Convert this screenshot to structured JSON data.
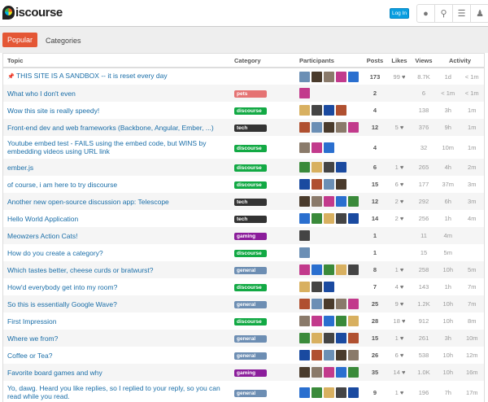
{
  "header": {
    "logo": "Discourse",
    "login": "Log In",
    "icons": [
      "chat-icon",
      "search-icon",
      "menu-icon",
      "user-icon"
    ]
  },
  "nav": {
    "popular": "Popular",
    "categories": "Categories"
  },
  "columns": {
    "topic": "Topic",
    "category": "Category",
    "participants": "Participants",
    "posts": "Posts",
    "likes": "Likes",
    "views": "Views",
    "activity": "Activity"
  },
  "colors": {
    "pets": "#e57373",
    "discourse": "#12a944",
    "tech": "#333333",
    "gaming": "#8b1d9b",
    "general": "#6d8eb3"
  },
  "rows": [
    {
      "title": "THIS SITE IS A SANDBOX -- it is reset every day",
      "pinned": true,
      "category": "",
      "avatars": 5,
      "posts": "173",
      "likes": "99",
      "views": "8.7K",
      "created": "1d",
      "last": "< 1m"
    },
    {
      "title": "What who I don't even",
      "category": "pets",
      "avatars": 1,
      "posts": "2",
      "likes": "",
      "views": "6",
      "created": "< 1m",
      "last": "< 1m"
    },
    {
      "title": "Wow this site is really speedy!",
      "category": "discourse",
      "avatars": 4,
      "posts": "4",
      "likes": "",
      "views": "138",
      "created": "3h",
      "last": "1m"
    },
    {
      "title": "Front-end dev and web frameworks (Backbone, Angular, Ember, ...)",
      "category": "tech",
      "avatars": 5,
      "posts": "12",
      "likes": "5",
      "views": "376",
      "created": "9h",
      "last": "1m"
    },
    {
      "title": "Youtube embed test - FAILS using the embed code, but WINS by embedding videos using URL link",
      "tall": true,
      "category": "discourse",
      "avatars": 3,
      "posts": "4",
      "likes": "",
      "views": "32",
      "created": "10m",
      "last": "1m"
    },
    {
      "title": "ember.js",
      "category": "discourse",
      "avatars": 4,
      "posts": "6",
      "likes": "1",
      "views": "265",
      "created": "4h",
      "last": "2m"
    },
    {
      "title": "of course, i am here to try discourse",
      "category": "discourse",
      "avatars": 4,
      "posts": "15",
      "likes": "6",
      "views": "177",
      "created": "37m",
      "last": "3m"
    },
    {
      "title": "Another new open-source discussion app: Telescope",
      "category": "tech",
      "avatars": 5,
      "posts": "12",
      "likes": "2",
      "views": "292",
      "created": "6h",
      "last": "3m"
    },
    {
      "title": "Hello World Application",
      "category": "tech",
      "avatars": 5,
      "posts": "14",
      "likes": "2",
      "views": "256",
      "created": "1h",
      "last": "4m"
    },
    {
      "title": "Meowzers Action Cats!",
      "category": "gaming",
      "avatars": 1,
      "posts": "1",
      "likes": "",
      "views": "11",
      "created": "4m",
      "last": ""
    },
    {
      "title": "How do you create a category?",
      "category": "discourse",
      "avatars": 1,
      "posts": "1",
      "likes": "",
      "views": "15",
      "created": "5m",
      "last": ""
    },
    {
      "title": "Which tastes better, cheese curds or bratwurst?",
      "category": "general",
      "avatars": 5,
      "posts": "8",
      "likes": "1",
      "views": "258",
      "created": "10h",
      "last": "5m"
    },
    {
      "title": "How'd everybody get into my room?",
      "category": "discourse",
      "avatars": 3,
      "posts": "7",
      "likes": "4",
      "views": "143",
      "created": "1h",
      "last": "7m"
    },
    {
      "title": "So this is essentially Google Wave?",
      "category": "general",
      "avatars": 5,
      "posts": "25",
      "likes": "9",
      "views": "1.2K",
      "created": "10h",
      "last": "7m"
    },
    {
      "title": "First Impression",
      "category": "discourse",
      "avatars": 5,
      "posts": "28",
      "likes": "18",
      "views": "912",
      "created": "10h",
      "last": "8m"
    },
    {
      "title": "Where we from?",
      "category": "general",
      "avatars": 5,
      "posts": "15",
      "likes": "1",
      "views": "261",
      "created": "3h",
      "last": "10m"
    },
    {
      "title": "Coffee or Tea?",
      "category": "general",
      "avatars": 5,
      "posts": "26",
      "likes": "6",
      "views": "538",
      "created": "10h",
      "last": "12m"
    },
    {
      "title": "Favorite board games and why",
      "category": "gaming",
      "avatars": 5,
      "posts": "35",
      "likes": "14",
      "views": "1.0K",
      "created": "10h",
      "last": "16m"
    },
    {
      "title": "Yo, dawg. Heard you like replies, so I replied to your reply, so you can read while you read.",
      "tall": true,
      "category": "general",
      "avatars": 5,
      "posts": "9",
      "likes": "1",
      "views": "196",
      "created": "7h",
      "last": "17m"
    }
  ]
}
